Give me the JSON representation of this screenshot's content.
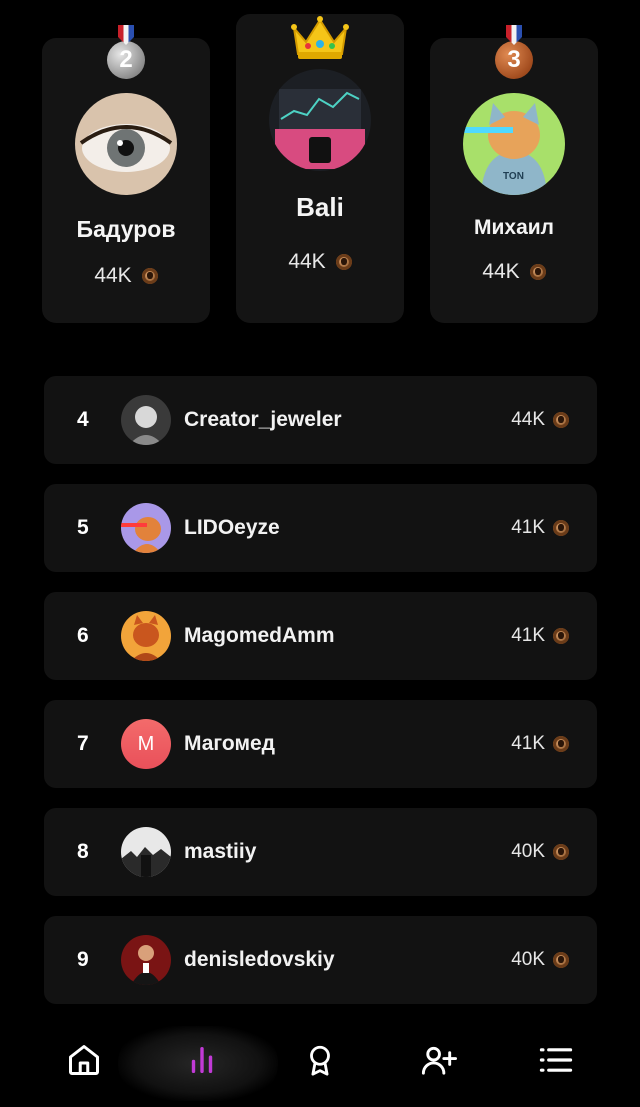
{
  "podium": [
    {
      "rank": "2",
      "medal": "silver-medal",
      "name": "Бадуров",
      "score": "44K"
    },
    {
      "rank": "1",
      "medal": "crown",
      "name": "Bali",
      "score": "44K"
    },
    {
      "rank": "3",
      "medal": "bronze-medal",
      "name": "Михаил",
      "score": "44K"
    }
  ],
  "leaderboard": [
    {
      "rank": "4",
      "name": "Creator_jeweler",
      "score": "44K"
    },
    {
      "rank": "5",
      "name": "LIDOeyze",
      "score": "41K"
    },
    {
      "rank": "6",
      "name": "MagomedAmm",
      "score": "41K"
    },
    {
      "rank": "7",
      "name": "Магомед",
      "avatar_letter": "M",
      "score": "41K"
    },
    {
      "rank": "8",
      "name": "mastiiy",
      "score": "40K"
    },
    {
      "rank": "9",
      "name": "denisledovskiy",
      "score": "40K"
    }
  ],
  "nav": {
    "items": [
      "home-icon",
      "leaderboard-icon",
      "award-icon",
      "add-friend-icon",
      "menu-list-icon"
    ],
    "active": "leaderboard-icon",
    "active_color": "#c13ad6"
  },
  "colors": {
    "background": "#000000",
    "card": "#141414",
    "coin": "#b0703c"
  }
}
